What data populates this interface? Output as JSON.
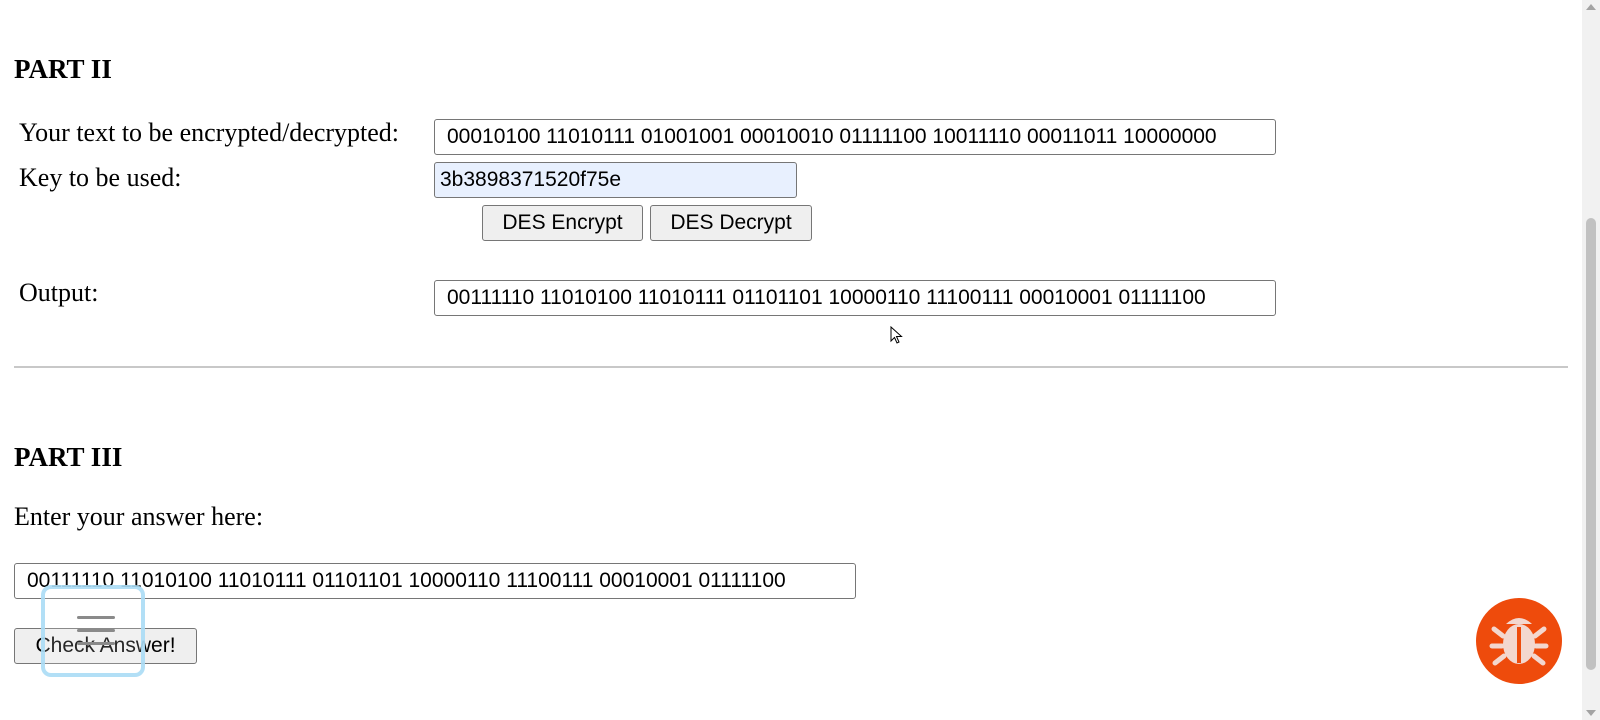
{
  "part2": {
    "heading": "PART II",
    "text_label": "Your text to be encrypted/decrypted:",
    "text_value": "00010100 11010111 01001001 00010010 01111100 10011110 00011011 10000000",
    "key_label": "Key to be used:",
    "key_value": "3b3898371520f75e",
    "encrypt_label": "DES Encrypt",
    "decrypt_label": "DES Decrypt",
    "output_label": "Output:",
    "output_value": "00111110 11010100 11010111 01101101 10000110 11100111 00010001 01111100"
  },
  "part3": {
    "heading": "PART III",
    "prompt_label": "Enter your answer here:",
    "answer_value": "00111110 11010100 11010111 01101101 10000110 11100111 00010001 01111100",
    "check_label": "Check Answer!"
  },
  "icons": {
    "menu": "hamburger-menu-icon",
    "bug": "bug-icon",
    "cursor": "mouse-pointer-icon"
  },
  "colors": {
    "bug_button": "#ee4b0c",
    "autofill": "#e8f0fe"
  }
}
